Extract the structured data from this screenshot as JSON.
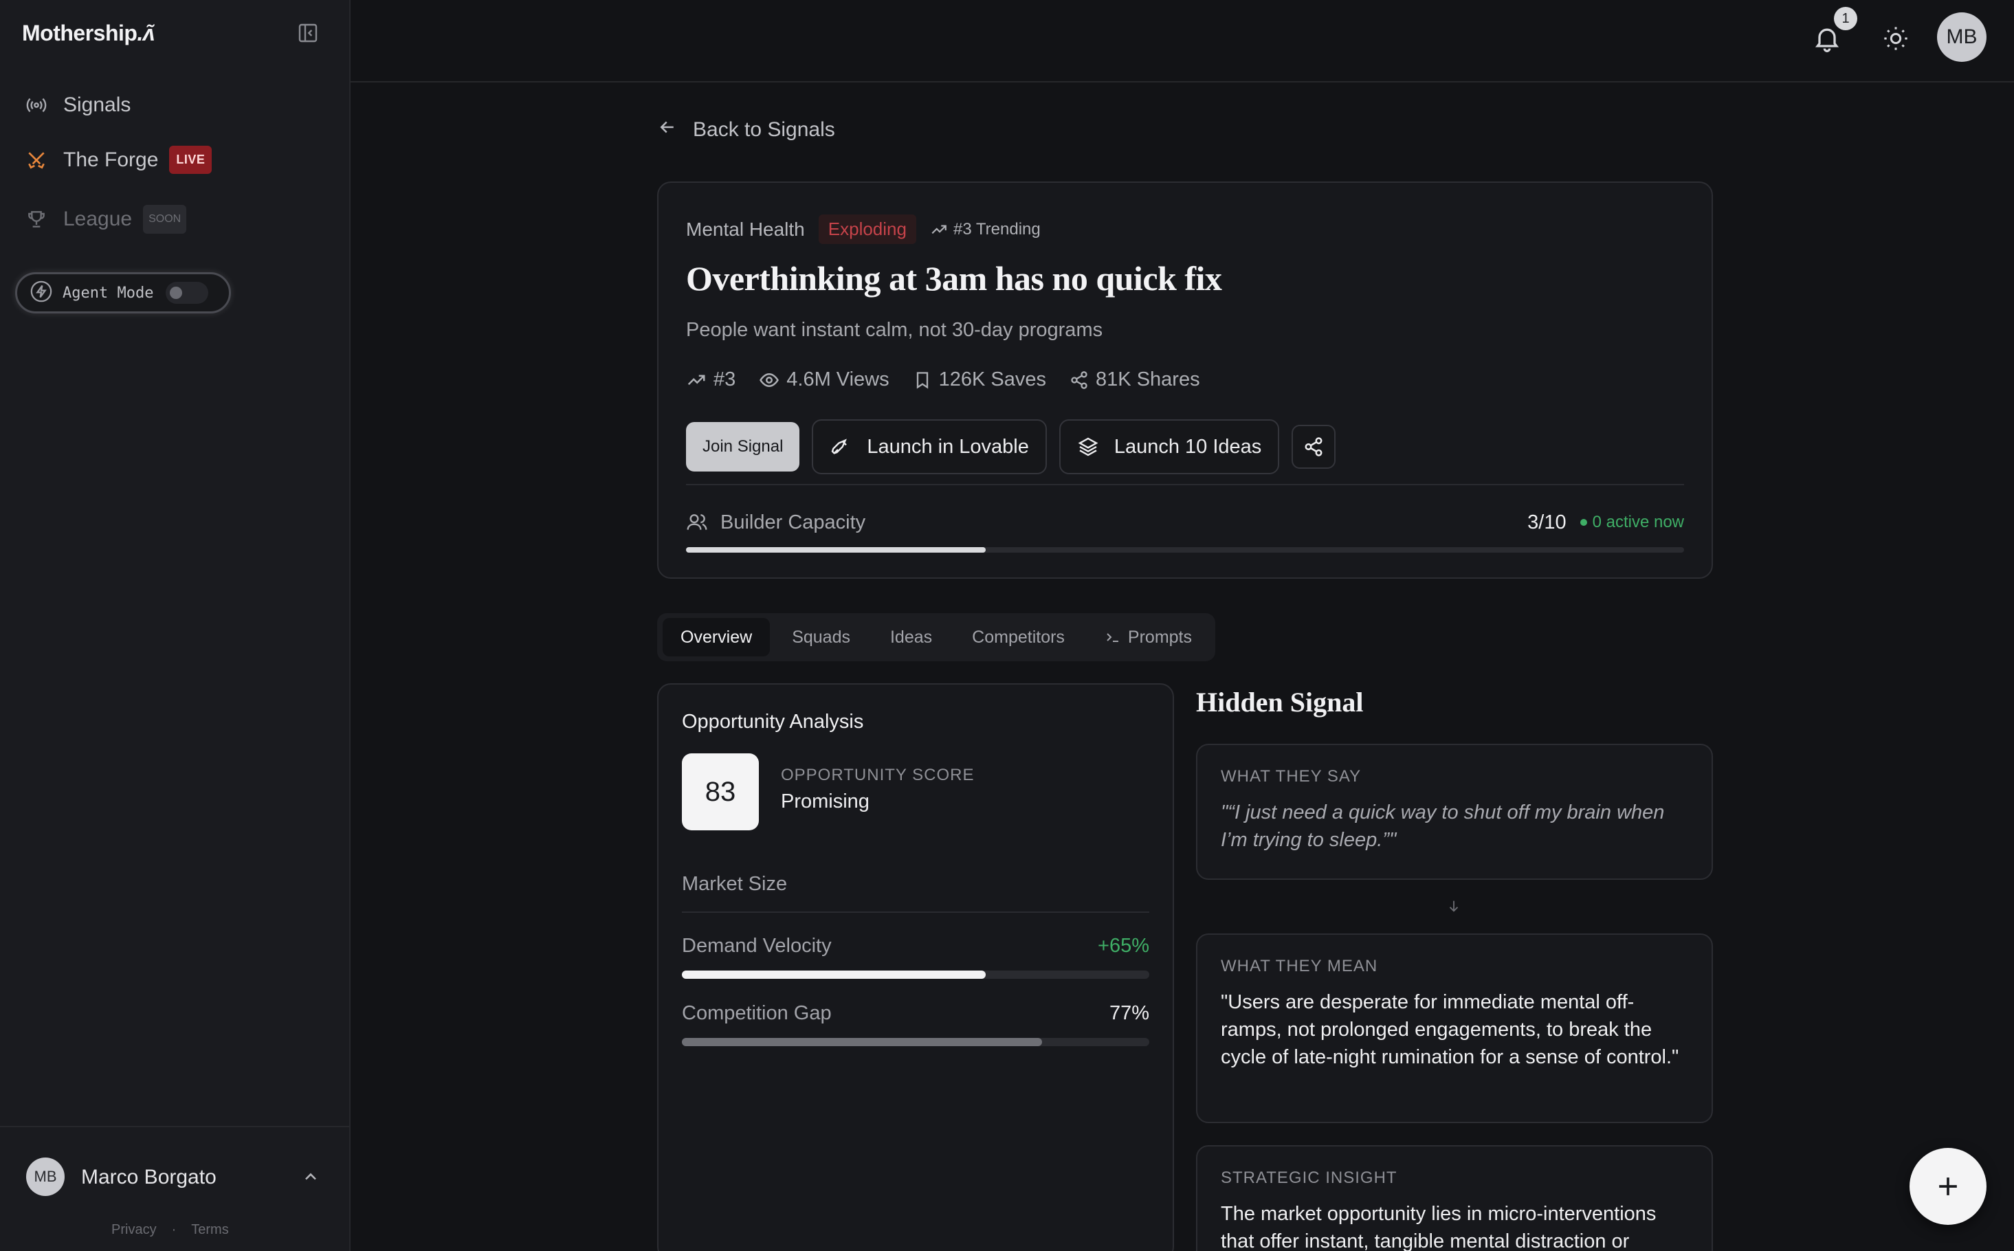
{
  "app": {
    "logo": "Mothership"
  },
  "sidebar": {
    "items": [
      {
        "label": "Signals",
        "icon": "broadcast-icon"
      },
      {
        "label": "The Forge",
        "icon": "crossed-swords-icon",
        "badge": "LIVE"
      },
      {
        "label": "League",
        "icon": "trophy-icon",
        "badge": "SOON"
      }
    ],
    "agent_mode": {
      "label": "Agent Mode",
      "enabled": false
    }
  },
  "user": {
    "initials": "MB",
    "name": "Marco Borgato"
  },
  "footer": {
    "privacy": "Privacy",
    "separator": "·",
    "terms": "Terms"
  },
  "topbar": {
    "notification_count": "1",
    "avatar_initials": "MB"
  },
  "back_link": "Back to Signals",
  "signal": {
    "category": "Mental Health",
    "status": "Exploding",
    "trending": "#3 Trending",
    "title": "Overthinking at 3am has no quick fix",
    "subtitle": "People want instant calm, not 30-day programs",
    "stats": {
      "rank": "#3",
      "views": "4.6M Views",
      "saves": "126K Saves",
      "shares": "81K Shares"
    },
    "buttons": {
      "join": "Join Signal",
      "lovable": "Launch in Lovable",
      "ideas": "Launch 10 Ideas"
    },
    "capacity": {
      "label": "Builder Capacity",
      "count": "3/10",
      "active": "0 active now",
      "fill": 0.3
    }
  },
  "tabs": [
    "Overview",
    "Squads",
    "Ideas",
    "Competitors",
    "Prompts"
  ],
  "opportunity": {
    "title": "Opportunity Analysis",
    "score": "83",
    "score_label": "OPPORTUNITY SCORE",
    "score_verdict": "Promising",
    "market_size": "Market Size",
    "demand_velocity": {
      "label": "Demand Velocity",
      "value": "+65%",
      "fill": 0.65
    },
    "competition_gap": {
      "label": "Competition Gap",
      "value": "77%",
      "fill": 0.77
    }
  },
  "hidden_signal": {
    "title": "Hidden Signal",
    "say_label": "WHAT THEY SAY",
    "say": "\"“I just need a quick way to shut off my brain when I’m trying to sleep.”\"",
    "mean_label": "WHAT THEY MEAN",
    "mean": "\"Users are desperate for immediate mental off-ramps, not prolonged engagements, to break the cycle of late-night rumination for a sense of control.\"",
    "insight_label": "STRATEGIC INSIGHT",
    "insight": "The market opportunity lies in micro-interventions that offer instant, tangible mental distraction or"
  },
  "colors": {
    "accent_green": "#3fae66",
    "exploding_red": "#c6434a",
    "live_badge": "#8c1d22"
  }
}
